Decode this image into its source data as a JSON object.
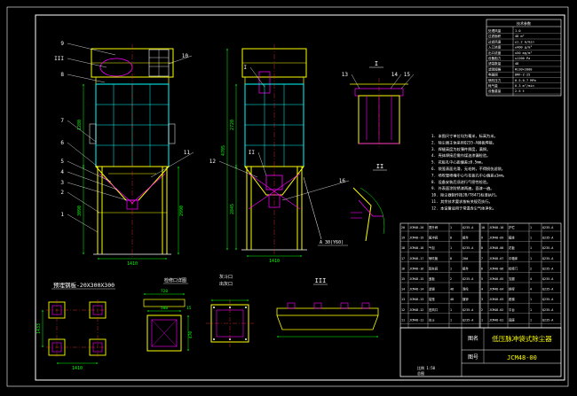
{
  "colors": {
    "background": "#000000",
    "frame": "#ffffff",
    "structure": "#ffff00",
    "outline": "#00ffff",
    "detail": "#ff00ff",
    "dimension": "#00ff00",
    "leader": "#ffffff",
    "section": "#ff3333",
    "text": "#ffffff"
  },
  "views": {
    "front": {
      "callouts": [
        "9",
        "III",
        "8",
        "10",
        "7",
        "6",
        "5",
        "4",
        "3",
        "2",
        "1",
        "11"
      ],
      "dims": {
        "width": "1410",
        "h1": "1280",
        "h2": "3090",
        "h3": "2990"
      }
    },
    "side": {
      "callouts": [
        "I",
        "12",
        "II",
        "16"
      ],
      "dims": {
        "width": "1410",
        "h1": "4705",
        "h2": "2720",
        "h3": "2845"
      }
    },
    "detail_I": {
      "label": "I",
      "callouts": [
        "13",
        "14",
        "15"
      ]
    },
    "detail_II": {
      "label": "II",
      "note": "A 30(Y60)"
    },
    "foundation": {
      "title": "预埋钢板-20X300X300",
      "dim_h": "1433",
      "dim_w": "1410"
    },
    "access_door": {
      "title": "检修口详图",
      "dims": [
        "720",
        "500",
        "15",
        "470"
      ]
    },
    "hopper_port": {
      "title": "灰斗口",
      "label": "出灰口"
    },
    "detail_III": {
      "label": "III"
    }
  },
  "spec_table": {
    "header": "技术参数",
    "rows": [
      [
        "处理风量",
        "1.0"
      ],
      [
        "过滤面积",
        "48 m²"
      ],
      [
        "过滤风速",
        "≤1.2 m/min"
      ],
      [
        "入口浓度",
        "≤400 g/m³"
      ],
      [
        "出口浓度",
        "≤50 mg/m³"
      ],
      [
        "设备阻力",
        "≤1200 Pa"
      ],
      [
        "滤袋数量",
        "48"
      ],
      [
        "滤袋规格",
        "Φ130×2000"
      ],
      [
        "电磁阀",
        "DMF-Z-25"
      ],
      [
        "喷吹压力",
        "0.5-0.7 MPa"
      ],
      [
        "耗气量",
        "0.3 m³/min"
      ],
      [
        "设备重量",
        "2.5 t"
      ]
    ]
  },
  "notes": [
    "1. 本图尺寸单位均为毫米，标高为米。",
    "2. 除尘器主体采用Q235-A钢板焊接。",
    "3. 焊缝高度为较薄件厚度，满焊。",
    "4. 壳体焊接后需作煤油渗漏检验。",
    "5. 花板孔中心距偏差±0.5mm。",
    "6. 袋笼表面光滑，无毛刺，不得损伤滤袋。",
    "7. 喷吹管喷嘴中心与花板孔中心偏差≤1mm。",
    "8. 设备安装后须进行气密性检验。",
    "9. 外表面涂防锈漆两遍，面漆一遍。",
    "10. 除尘器制作按JB/T8471标准执行。",
    "11. 其余技术要求按有关规范执行。",
    "12. 本设备适用于常温含尘气体净化。"
  ],
  "parts": [
    [
      "20",
      "JCM48-20",
      "提升阀",
      "1",
      "",
      "Q235-A"
    ],
    [
      "19",
      "JCM48-19",
      "脉冲阀",
      "8",
      "",
      "组件"
    ],
    [
      "18",
      "JCM48-18",
      "气包",
      "1",
      "",
      "Q235-A"
    ],
    [
      "17",
      "JCM48-17",
      "喷吹管",
      "8",
      "",
      "20#"
    ],
    [
      "16",
      "JCM48-16",
      "卸灰阀",
      "1",
      "",
      "组件"
    ],
    [
      "15",
      "JCM48-15",
      "盖板",
      "2",
      "",
      "Q235-A"
    ],
    [
      "14",
      "JCM48-14",
      "滤袋",
      "48",
      "",
      "涤纶"
    ],
    [
      "13",
      "JCM48-13",
      "袋笼",
      "48",
      "",
      "镀锌"
    ],
    [
      "12",
      "JCM48-12",
      "进风口",
      "1",
      "",
      "Q235-A"
    ],
    [
      "11",
      "JCM48-11",
      "灰斗",
      "1",
      "",
      "Q235-A"
    ],
    [
      "10",
      "JCM48-10",
      "护栏",
      "1",
      "",
      "Q235-A"
    ],
    [
      "9",
      "JCM48-09",
      "箱体",
      "1",
      "",
      "Q235-A"
    ],
    [
      "8",
      "JCM48-08",
      "花板",
      "1",
      "",
      "Q235-A"
    ],
    [
      "7",
      "JCM48-07",
      "中箱体",
      "1",
      "",
      "Q235-A"
    ],
    [
      "6",
      "JCM48-06",
      "检修门",
      "2",
      "",
      "Q235-A"
    ],
    [
      "5",
      "JCM48-05",
      "支腿",
      "4",
      "",
      "Q235-A"
    ],
    [
      "4",
      "JCM48-04",
      "斜撑",
      "4",
      "",
      "Q235-A"
    ],
    [
      "3",
      "JCM48-03",
      "爬梯",
      "1",
      "",
      "Q235-A"
    ],
    [
      "2",
      "JCM48-02",
      "平台",
      "1",
      "",
      "Q235-A"
    ],
    [
      "1",
      "JCM48-01",
      "底座",
      "1",
      "",
      "Q235-A"
    ]
  ],
  "title_block": {
    "label_name": "图名",
    "name": "低压脉冲袋式除尘器",
    "label_no": "图号",
    "number": "JCM48-00",
    "sub": "比例 1:50",
    "bottom": "总图"
  }
}
